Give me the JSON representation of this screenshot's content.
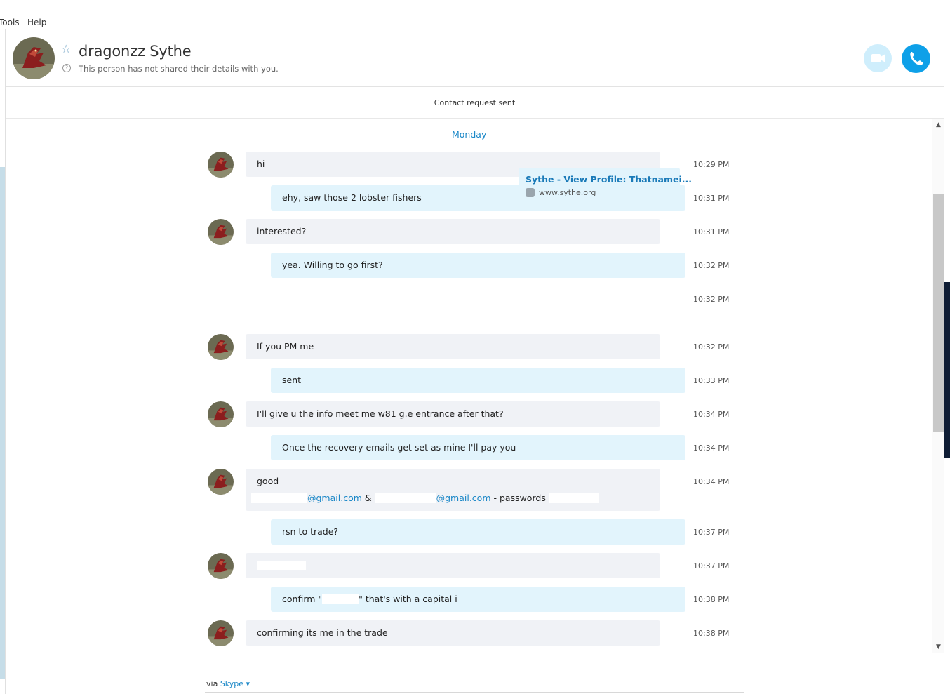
{
  "menu": {
    "items": [
      "Tools",
      "Help"
    ]
  },
  "header": {
    "contact_name": "dragonzz Sythe",
    "subtitle": "This person has not shared their details with you.",
    "video_button": "video-call",
    "call_button": "audio-call"
  },
  "request_banner": "Contact request sent",
  "day_label": "Monday",
  "messages": [
    {
      "from": "them",
      "text": "hi",
      "time": "10:29 PM"
    },
    {
      "from": "me",
      "text": "ehy, saw those 2 lobster fishers",
      "time": "10:31 PM"
    },
    {
      "from": "them",
      "text": "interested?",
      "time": "10:31 PM"
    },
    {
      "from": "me",
      "text": "yea. Willing to go first?",
      "time": "10:32 PM"
    },
    {
      "from": "me",
      "type": "link",
      "title": "Sythe - View Profile: Thatnamei...",
      "url": "www.sythe.org",
      "time": "10:32 PM"
    },
    {
      "from": "them",
      "text": "If you PM me",
      "time": "10:32 PM"
    },
    {
      "from": "me",
      "text": "sent",
      "time": "10:33 PM"
    },
    {
      "from": "them",
      "text": "I'll give u the info meet me w81 g.e entrance after that?",
      "time": "10:34 PM"
    },
    {
      "from": "me",
      "text": "Once the recovery emails get set as mine I'll pay you",
      "time": "10:34 PM"
    },
    {
      "from": "them",
      "text": "good",
      "line2_email1": "@gmail.com",
      "line2_amp": "&",
      "line2_email2": "@gmail.com",
      "line2_tail": "- passwords",
      "time": "10:34 PM"
    },
    {
      "from": "me",
      "text": "rsn to trade?",
      "time": "10:37 PM"
    },
    {
      "from": "them",
      "text": "",
      "time": "10:37 PM"
    },
    {
      "from": "me",
      "text_pre": "confirm \"",
      "text_post": "\" that's with a capital i",
      "time": "10:38 PM"
    },
    {
      "from": "them",
      "text": "confirming its me in the trade",
      "time": "10:38 PM"
    }
  ],
  "footer": {
    "via": "via",
    "via_app": "Skype"
  },
  "colors": {
    "accent": "#1a87c7",
    "call": "#0ea0e8",
    "video": "#cfeefc",
    "bubble_in": "#f0f2f6",
    "bubble_out": "#e2f4fc"
  }
}
